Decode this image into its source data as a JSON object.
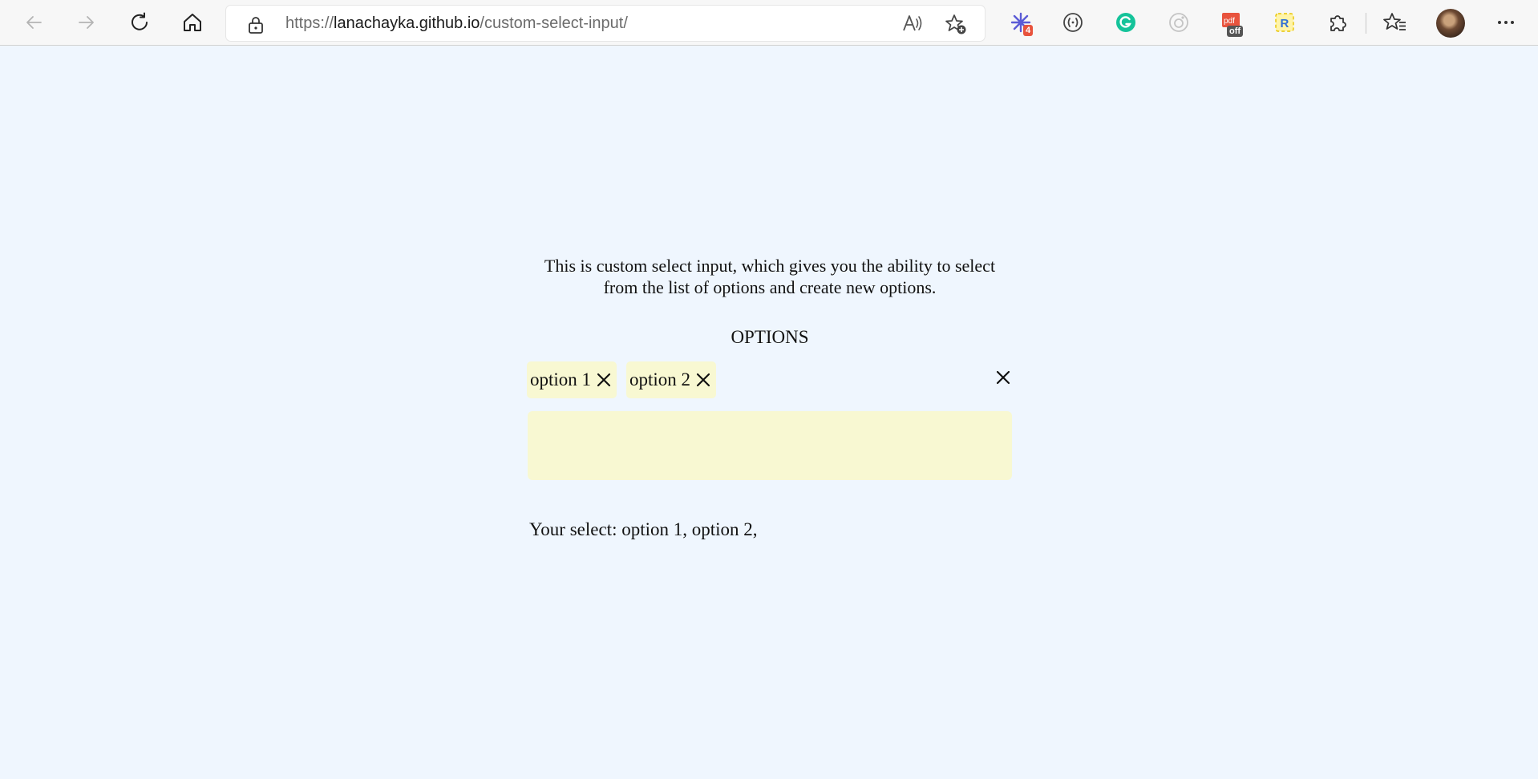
{
  "browser": {
    "url_prefix": "https://",
    "url_host": "lanachayka.github.io",
    "url_path": "/custom-select-input/",
    "extensions": [
      {
        "icon": "snowflake-extension-icon",
        "badge": "4",
        "color": "#5b5bd6",
        "badge_color": "#e8533d"
      },
      {
        "icon": "code-braces-extension-icon",
        "badge": "",
        "color": "#444444"
      },
      {
        "icon": "grammarly-extension-icon",
        "badge": "",
        "color": "#15c39a"
      },
      {
        "icon": "camera-extension-icon",
        "badge": "",
        "color": "#bdbdbd"
      },
      {
        "icon": "pdf-extension-icon",
        "badge": "off",
        "color": "#e8533d",
        "badge_color": "#555555"
      },
      {
        "icon": "r-extension-icon",
        "badge": "",
        "color": "#2f6fd6"
      },
      {
        "icon": "puzzle-extensions-icon",
        "badge": "",
        "color": "#333333"
      }
    ]
  },
  "page": {
    "intro": "This is custom select input, which gives you the ability to select from the list of options and create new options.",
    "options_title": "OPTIONS",
    "selected": [
      {
        "label": "option 1"
      },
      {
        "label": "option 2"
      }
    ],
    "input_value": "",
    "result_text": "Your select: option 1, option 2,"
  },
  "colors": {
    "page_background": "#eff6fe",
    "chip_background": "#f8f8d2",
    "input_background": "#f8f8d2"
  }
}
